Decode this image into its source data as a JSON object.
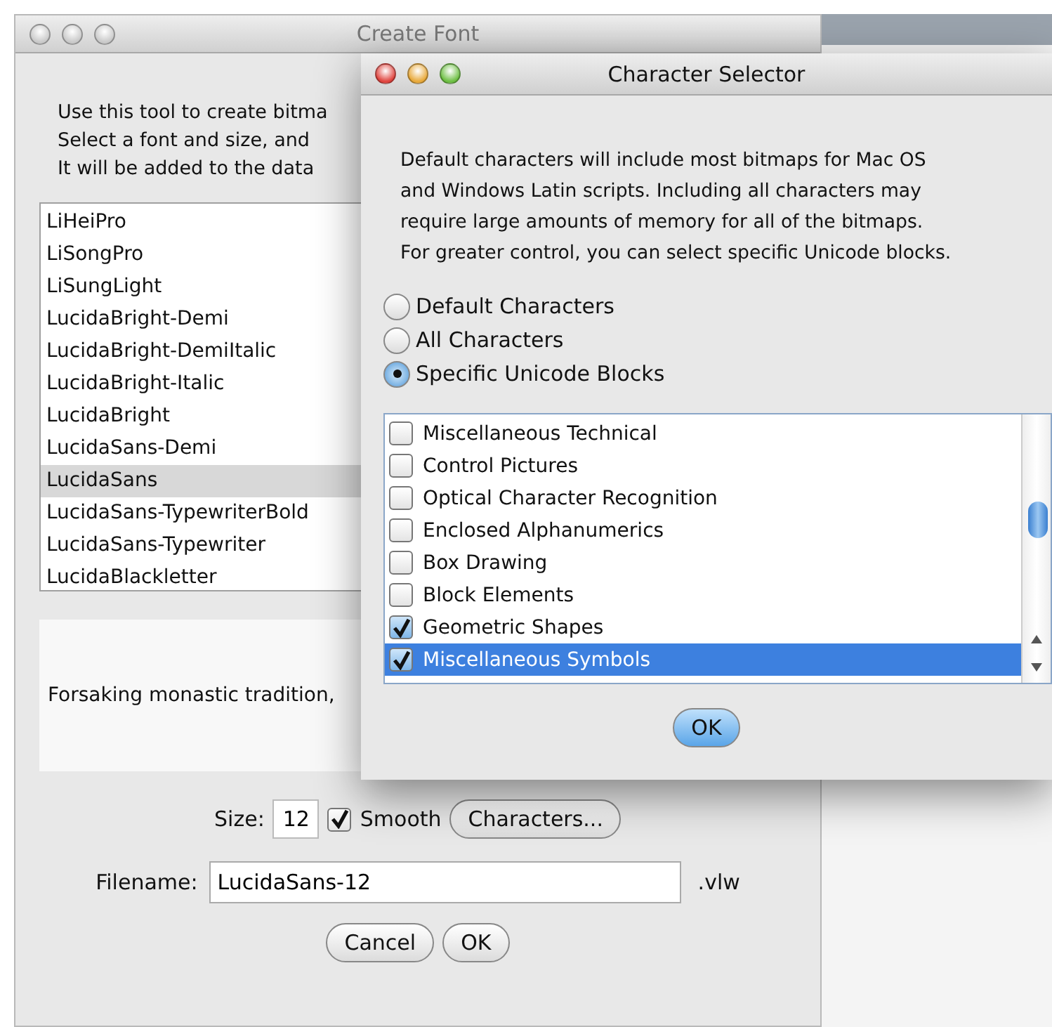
{
  "create_font": {
    "title": "Create Font",
    "instructions": [
      "Use this tool to create bitma",
      "Select a font and size, and",
      "It will be added to the data"
    ],
    "fonts": [
      {
        "name": "LiHeiPro",
        "selected": false
      },
      {
        "name": "LiSongPro",
        "selected": false
      },
      {
        "name": "LiSungLight",
        "selected": false
      },
      {
        "name": "LucidaBright-Demi",
        "selected": false
      },
      {
        "name": "LucidaBright-DemiItalic",
        "selected": false
      },
      {
        "name": "LucidaBright-Italic",
        "selected": false
      },
      {
        "name": "LucidaBright",
        "selected": false
      },
      {
        "name": "LucidaSans-Demi",
        "selected": false
      },
      {
        "name": "LucidaSans",
        "selected": true
      },
      {
        "name": "LucidaSans-TypewriterBold",
        "selected": false
      },
      {
        "name": "LucidaSans-Typewriter",
        "selected": false
      },
      {
        "name": "LucidaBlackletter",
        "selected": false
      }
    ],
    "preview": "Forsaking monastic tradition,",
    "size_label": "Size:",
    "size": "12",
    "smooth": {
      "label": "Smooth",
      "checked": true
    },
    "characters_button": "Characters...",
    "filename_label": "Filename:",
    "filename": "LucidaSans-12",
    "extension": ".vlw",
    "buttons": [
      "Cancel",
      "OK"
    ]
  },
  "character_selector": {
    "title": "Character Selector",
    "description_lines": [
      "Default characters will include most bitmaps for Mac OS",
      "and Windows Latin scripts. Including all characters may",
      "require large amounts of memory for all of the bitmaps.",
      "For greater control, you can select specific Unicode blocks."
    ],
    "options": [
      {
        "label": "Default Characters",
        "selected": false
      },
      {
        "label": "All Characters",
        "selected": false
      },
      {
        "label": "Specific Unicode Blocks",
        "selected": true
      }
    ],
    "blocks": [
      {
        "name": "Miscellaneous Technical",
        "checked": false,
        "selected": false
      },
      {
        "name": "Control Pictures",
        "checked": false,
        "selected": false
      },
      {
        "name": "Optical Character Recognition",
        "checked": false,
        "selected": false
      },
      {
        "name": "Enclosed Alphanumerics",
        "checked": false,
        "selected": false
      },
      {
        "name": "Box Drawing",
        "checked": false,
        "selected": false
      },
      {
        "name": "Block Elements",
        "checked": false,
        "selected": false
      },
      {
        "name": "Geometric Shapes",
        "checked": true,
        "selected": false
      },
      {
        "name": "Miscellaneous Symbols",
        "checked": true,
        "selected": true
      }
    ],
    "ok_button": "OK"
  }
}
